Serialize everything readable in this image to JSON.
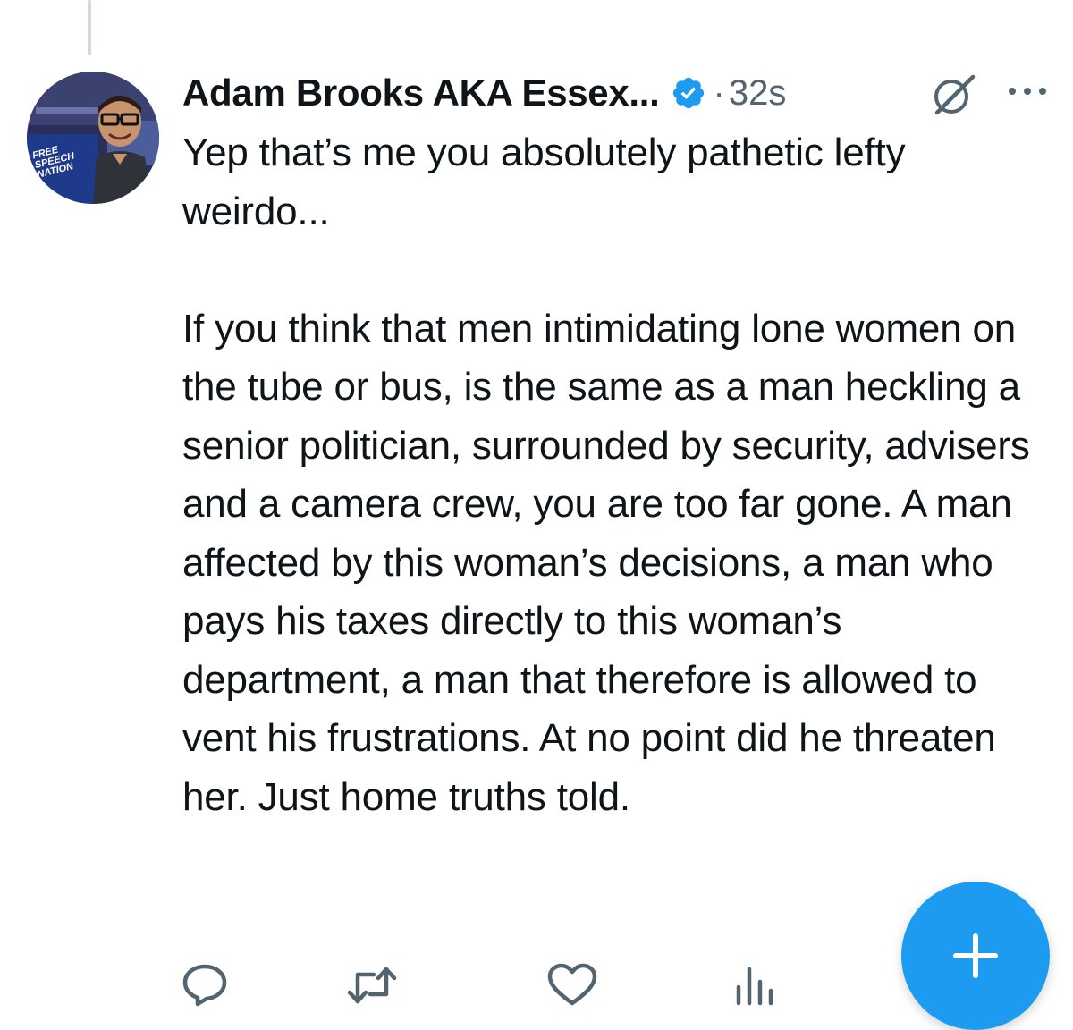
{
  "tweet": {
    "author_name": "Adam Brooks AKA Essex...",
    "timestamp": "32s",
    "dot": "·",
    "avatar_badge_text": [
      "FREE",
      "SPEECH",
      "NATION"
    ],
    "paragraphs": [
      "Yep that’s me you absolutely pathetic lefty weirdo...",
      "If you think that men intimidating lone women on the tube or bus, is the same as a man heckling a senior politician, surrounded by security, advisers and a camera crew, you are too far gone. A man affected by this woman’s decisions, a man who pays his taxes directly to this woman’s department, a man that therefore is allowed to vent his frustrations. At no point did he threaten her. Just home truths told."
    ]
  },
  "icons": {
    "verified": "verified-badge-icon",
    "grok": "grok-icon",
    "more": "more-options-icon",
    "reply": "reply-icon",
    "repost": "repost-icon",
    "like": "like-icon",
    "views": "views-icon",
    "compose": "compose-plus-icon"
  },
  "colors": {
    "accent": "#1d9bf0",
    "text_primary": "#0f1419",
    "text_secondary": "#536471",
    "thread_line": "#cfd9de"
  }
}
